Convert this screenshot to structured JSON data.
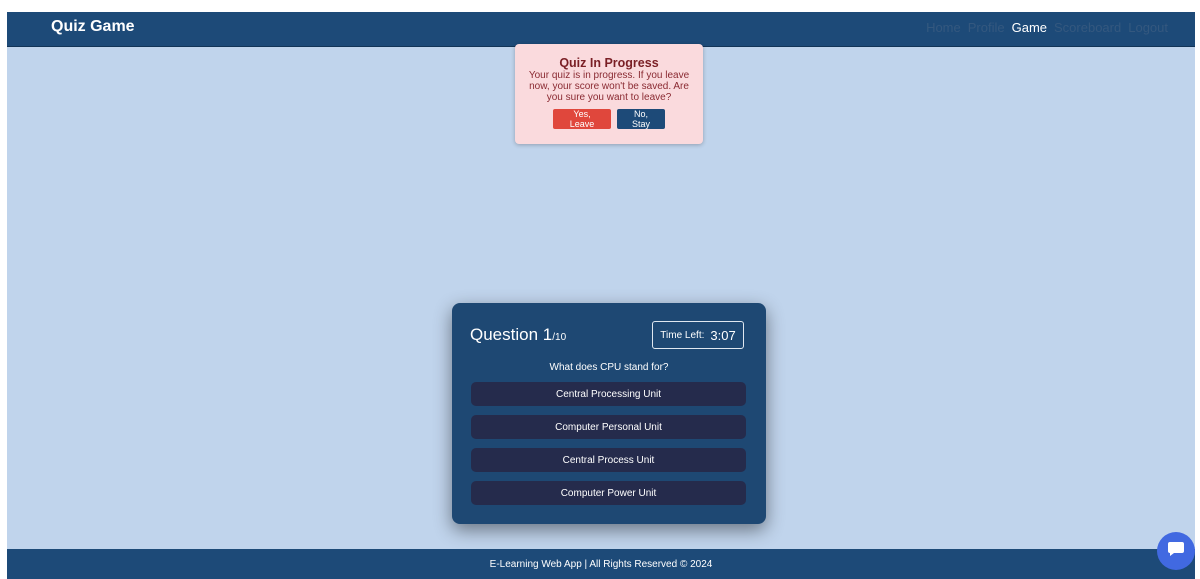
{
  "navbar": {
    "brand": "Quiz Game",
    "links": [
      "Home",
      "Profile",
      "Game",
      "Scoreboard",
      "Logout"
    ],
    "active_link": "Game"
  },
  "modal": {
    "title": "Quiz In Progress",
    "message": "Your quiz is in progress. If you leave now, your score won't be saved. Are you sure you want to leave?",
    "leave_label": "Yes, Leave",
    "stay_label": "No, Stay"
  },
  "quiz": {
    "question_word": "Question 1",
    "question_total": "/10",
    "timer_label": "Time Left:",
    "timer_value": "3:07",
    "question_text": "What does CPU stand for?",
    "answers": [
      "Central Processing Unit",
      "Computer Personal Unit",
      "Central Process Unit",
      "Computer Power Unit"
    ]
  },
  "footer": {
    "text": "E-Learning Web App | All Rights Reserved © 2024"
  },
  "chat": {
    "icon": "chat-bubble-icon"
  },
  "colors": {
    "navbar": "#1d4a78",
    "background": "#c0d4ec",
    "card": "#1e4873",
    "answer": "#252b4c",
    "leave_button": "#e0473c",
    "modal_bg": "#fadadd",
    "chat_button": "#4169e1"
  }
}
